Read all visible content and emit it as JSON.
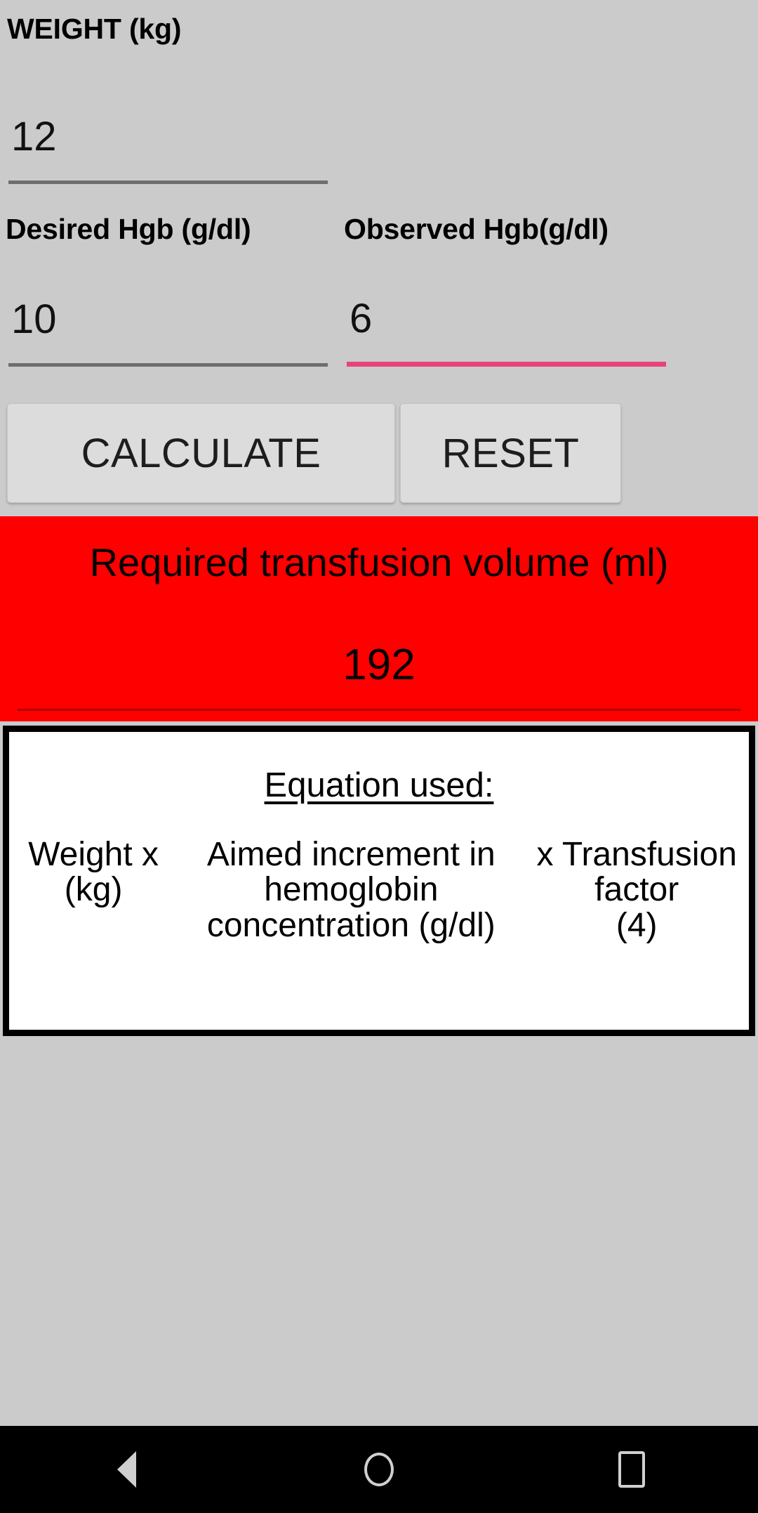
{
  "app": {
    "background_color": "#cbcbcb"
  },
  "form": {
    "weight": {
      "label": "WEIGHT (kg)",
      "value": "12",
      "placeholder": "",
      "focused": false
    },
    "desired_hgb": {
      "label": "Desired Hgb (g/dl)",
      "value": "10",
      "placeholder": "",
      "focused": false
    },
    "observed_hgb": {
      "label": "Observed Hgb(g/dl)",
      "value": "6",
      "placeholder": "",
      "focused": true,
      "focus_color": "#e8437b"
    }
  },
  "actions": {
    "calculate_label": "CALCULATE",
    "reset_label": "RESET"
  },
  "result": {
    "title": "Required transfusion volume (ml)",
    "value": "192",
    "background_color": "#ff0000",
    "text_color": "#000000"
  },
  "equation": {
    "heading": "Equation used:",
    "columns": [
      {
        "line1": "Weight x",
        "line2": "(kg)",
        "line3": ""
      },
      {
        "line1": "Aimed increment in",
        "line2": "hemoglobin",
        "line3": "concentration (g/dl)"
      },
      {
        "line1": "x Transfusion",
        "line2": "factor",
        "line3": "(4)"
      }
    ]
  },
  "navbar": {
    "back_label": "Back",
    "home_label": "Home",
    "recents_label": "Recents"
  }
}
